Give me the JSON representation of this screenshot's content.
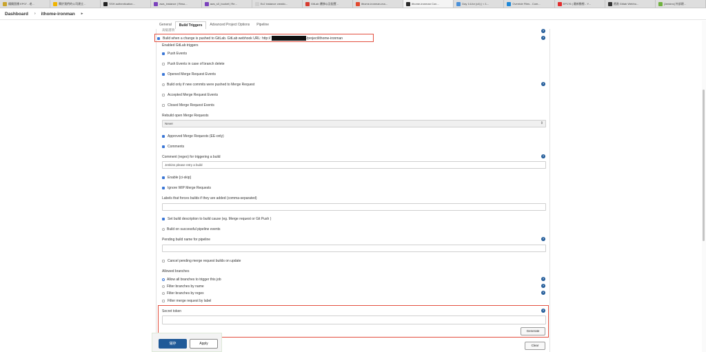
{
  "browser": {
    "tabs": [
      {
        "label": "鐵鏡直播 EP07 - 老...",
        "fav": "#c9a42c"
      },
      {
        "label": "關於我們的公司建立...",
        "fav": "#f0b400"
      },
      {
        "label": "SSH authentication...",
        "fav": "#222222"
      },
      {
        "label": "aws_instance | Reso...",
        "fav": "#7b42bc"
      },
      {
        "label": "aws_s3_bucket | Re...",
        "fav": "#7b42bc"
      },
      {
        "label": "Ec2 instance creatio...",
        "fav": "#cfcfcf"
      },
      {
        "label": "GitLab 遷移以及配置...",
        "fav": "#d73b2f"
      },
      {
        "label": "ithome-ironman-ma...",
        "fav": "#e2492f"
      },
      {
        "label": "ithome-ironman Con...",
        "fav": "#2a2a2a"
      },
      {
        "label": "Day 14-for (c4) | < 1...",
        "fav": "#4a90d9"
      },
      {
        "label": "Override Files - Com...",
        "fav": "#1f88d8"
      },
      {
        "label": "EP176 | 最新動態 - Y...",
        "fav": "#e22c2c"
      },
      {
        "label": "透過 Gitlab Webho...",
        "fav": "#333333"
      },
      {
        "label": "[Jenkins] 外部建...",
        "fav": "#6fb13e"
      }
    ]
  },
  "breadcrumb": {
    "dashboard": "Dashboard",
    "sep": "›",
    "project": "ithome-ironman",
    "sep2": "▸"
  },
  "config_tabs": {
    "general": "General",
    "build_triggers": "Build Triggers",
    "advanced": "Advanced Project Options",
    "pipeline": "Pipeline"
  },
  "form": {
    "cut_top_text": "高級選項",
    "build_when_pushed": "Build when a change is pushed to GitLab. GitLab webhook URL: http://",
    "webhook_suffix": "/project/ithome-ironman",
    "enabled_triggers_label": "Enabled GitLab triggers",
    "push_events": "Push Events",
    "push_events_branch_delete": "Push Events in case of branch delete",
    "opened_mr_events": "Opened Merge Request Events",
    "build_only_new_commits": "Build only if new commits were pushed to Merge Request",
    "accepted_mr_events": "Accepted Merge Request Events",
    "closed_mr_events": "Closed Merge Request Events",
    "rebuild_open_mr_label": "Rebuild open Merge Requests",
    "rebuild_open_mr_value": "Never",
    "approved_mr": "Approved Merge Requests (EE-only)",
    "comments": "Comments",
    "comment_regex_label": "Comment (regex) for triggering a build",
    "comment_regex_value": "Jenkins please retry a build",
    "enable_ci_skip": "Enable [ci-skip]",
    "ignore_wip": "Ignore WIP Merge Requests",
    "labels_force_label": "Labels that forces builds if they are added (comma-separated)",
    "labels_force_value": "",
    "set_build_desc": "Set build description to build cause (eg. Merge request or Git Push )",
    "build_on_pipeline": "Build on successful pipeline events",
    "pending_build_name_label": "Pending build name for pipeline",
    "pending_build_name_value": "",
    "cancel_pending": "Cancel pending merge request builds on update",
    "allowed_branches_label": "Allowed branches",
    "allow_all": "Allow all branches to trigger this job",
    "filter_by_name": "Filter branches by name",
    "filter_by_regex": "Filter branches by regex",
    "filter_mr_by_label": "Filter merge request by label",
    "secret_token_label": "Secret token",
    "secret_token_value": "",
    "help_glyph": "?"
  },
  "buttons": {
    "generate": "Generate",
    "save": "儲存",
    "apply": "Apply",
    "clear": "Clear"
  },
  "colors": {
    "accent": "#205a98",
    "checkbox_checked": "#3a76d6",
    "highlight_box": "#e34f3f"
  }
}
